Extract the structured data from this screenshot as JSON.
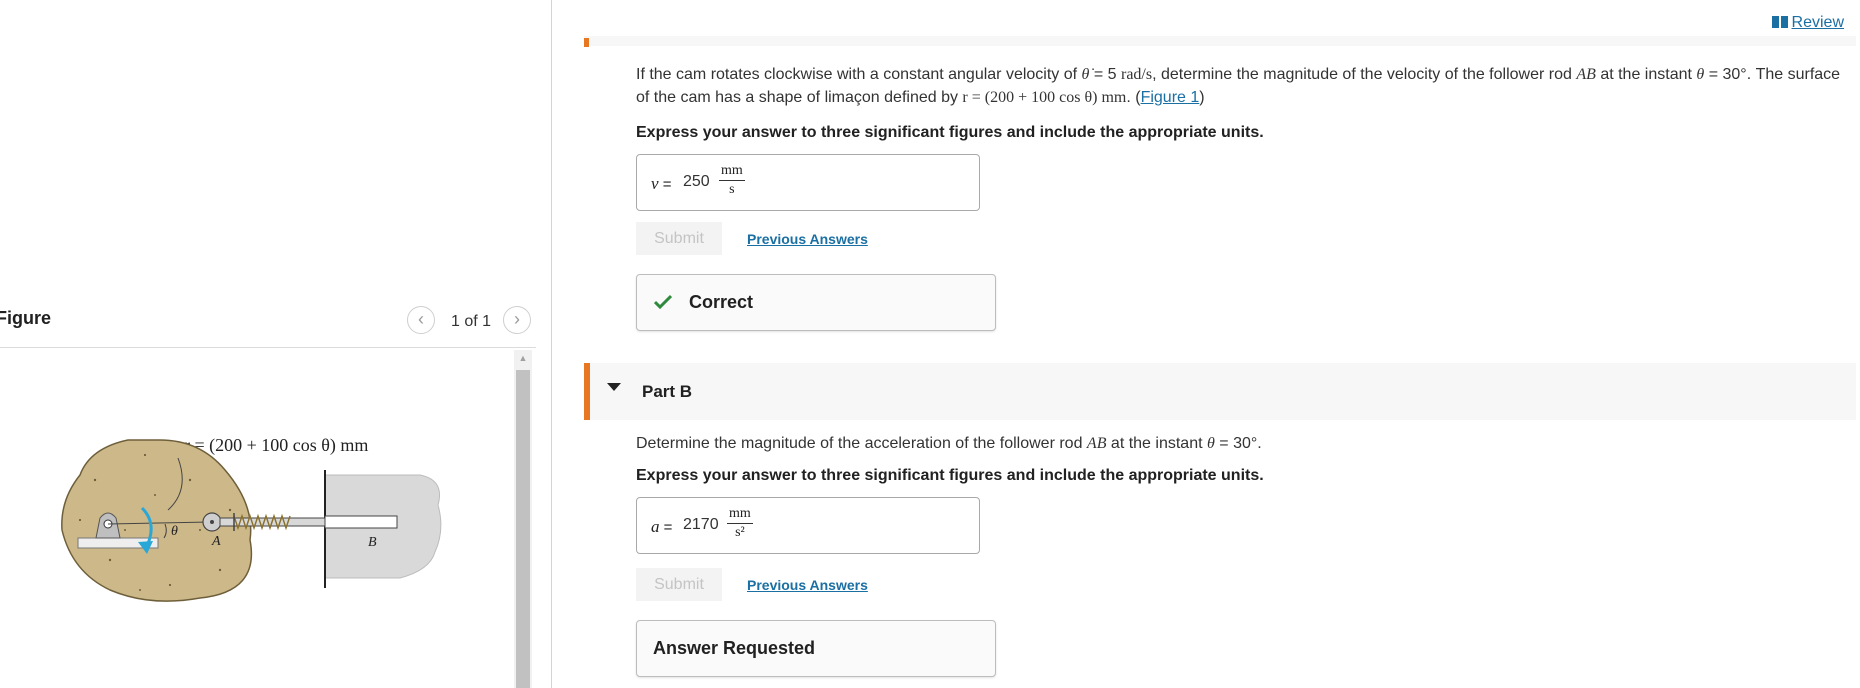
{
  "figure_panel": {
    "title": "Figure",
    "counter": "1 of 1",
    "image": {
      "equation_label": "r = (200 + 100 cos θ) mm",
      "label_theta": "θ",
      "label_A": "A",
      "label_B": "B"
    }
  },
  "header": {
    "review_label": "Review"
  },
  "part_a": {
    "question_pre": "If the cam rotates clockwise with a constant angular velocity of ",
    "theta_dot_symbol": "θ̇",
    "omega_value": " = 5 ",
    "omega_units": "rad/s",
    "question_mid": ", determine the magnitude of the velocity of the follower rod ",
    "rod": "AB",
    "question_at": " at the instant ",
    "theta_symbol": "θ",
    "theta_value": " = 30°",
    "question_cont": ". The surface of the cam has a shape of limaçon defined by ",
    "limacon_equation": "r = (200 + 100 cos θ) mm",
    "question_end": ".",
    "figure_link": "Figure 1",
    "instruction": "Express your answer to three significant figures and include the appropriate units.",
    "answer": {
      "variable": "v",
      "equals": " =",
      "value": "250",
      "unit_num": "mm",
      "unit_den": "s"
    },
    "submit_label": "Submit",
    "previous_answers_label": "Previous Answers",
    "feedback": "Correct"
  },
  "part_b": {
    "title": "Part B",
    "question_pre": "Determine the magnitude of the acceleration of the follower rod ",
    "rod": "AB",
    "question_at": " at the instant ",
    "theta_symbol": "θ",
    "theta_value": " = 30°",
    "question_end": ".",
    "instruction": "Express your answer to three significant figures and include the appropriate units.",
    "answer": {
      "variable": "a",
      "equals": " =",
      "value": "2170",
      "unit_num": "mm",
      "unit_den": "s²"
    },
    "submit_label": "Submit",
    "previous_answers_label": "Previous Answers",
    "feedback": "Answer Requested"
  },
  "colors": {
    "accent_orange": "#e87722",
    "link_blue": "#1a6fa3",
    "correct_green": "#2e8b3d",
    "cam_fill": "#cdb889",
    "arrow_cyan": "#29a8d8"
  }
}
